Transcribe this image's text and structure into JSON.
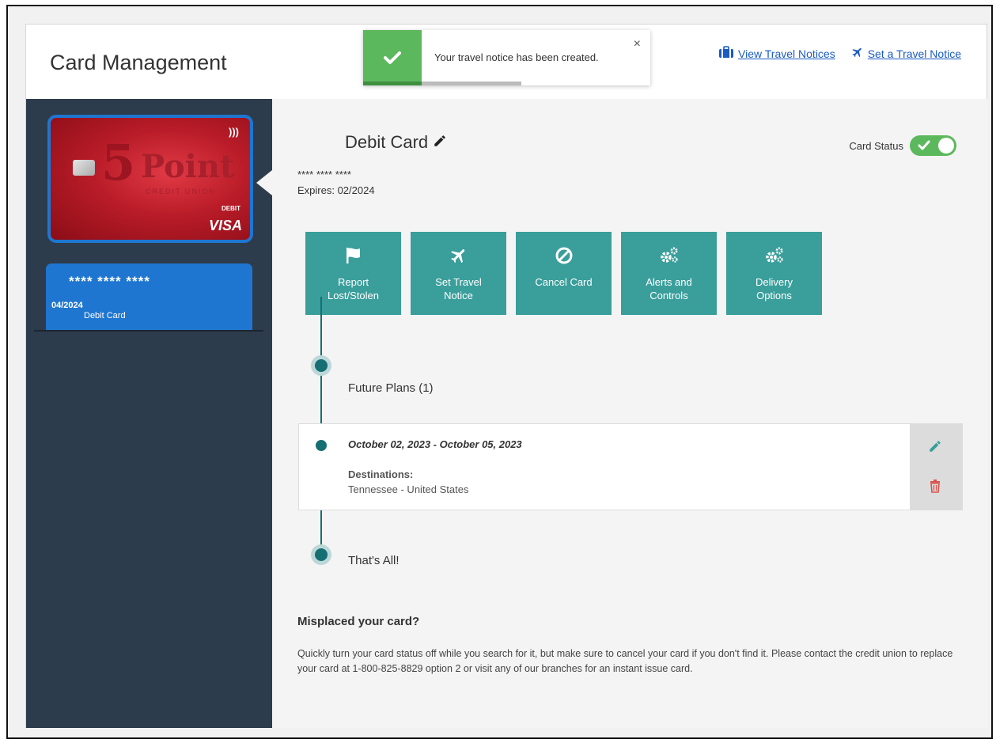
{
  "header": {
    "title": "Card Management",
    "links": {
      "view_travel": "View Travel Notices",
      "set_travel": "Set a Travel Notice"
    }
  },
  "toast": {
    "message": "Your travel notice has been created.",
    "close": "×",
    "progress_percent": 37
  },
  "sidebar": {
    "card_image": {
      "brand_number": "5",
      "brand_word": "Point",
      "brand_subtitle": "CREDIT UNION",
      "type": "DEBIT",
      "network": "VISA",
      "contactless": ")))"
    },
    "card_tile": {
      "number": "**** **** ****",
      "expiry": "04/2024",
      "name": "Debit Card"
    }
  },
  "main": {
    "card_title": "Debit Card",
    "card_number": "**** **** ****",
    "expires": "Expires: 02/2024",
    "status_label": "Card Status",
    "status_on": true,
    "actions": [
      {
        "line1": "Report",
        "line2": "Lost/Stolen"
      },
      {
        "line1": "Set Travel",
        "line2": "Notice"
      },
      {
        "line1": "Cancel Card",
        "line2": ""
      },
      {
        "line1": "Alerts and",
        "line2": "Controls"
      },
      {
        "line1": "Delivery",
        "line2": "Options"
      }
    ],
    "timeline": {
      "future_label": "Future Plans (1)",
      "end_label": "That's All!",
      "plans": [
        {
          "dates": "October 02, 2023 - October 05, 2023",
          "destinations_label": "Destinations:",
          "destinations": "Tennessee - United States"
        }
      ]
    },
    "misplaced": {
      "title": "Misplaced your card?",
      "text": "Quickly turn your card status off while you search for it, but make sure to cancel your card if you don't find it. Please contact the credit union to replace your card at 1-800-825-8829 option 2 or visit any of our branches for an instant issue card."
    }
  },
  "colors": {
    "teal": "#3a9e9b",
    "success": "#5cb85c",
    "sidebar": "#2d3c4c",
    "tile_blue": "#1f76d0",
    "link": "#1a5bc4",
    "delete_red": "#d9534f"
  }
}
